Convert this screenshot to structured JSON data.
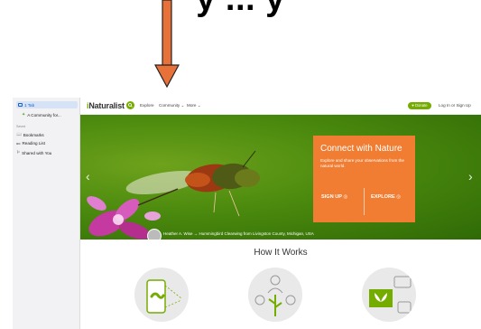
{
  "caption": "y ... y",
  "sidebar": {
    "tabs_label": "1 Tab",
    "tab_item": "A Community for...",
    "saved_label": "Saved",
    "items": [
      "Bookmarks",
      "Reading List",
      "Shared with You"
    ]
  },
  "nav": {
    "logo": "Naturalist",
    "logo_i": "i",
    "items": [
      "Explore",
      "Community",
      "More"
    ],
    "donate": "Donate",
    "login": "Log In",
    "or": "or",
    "signup": "Sign Up"
  },
  "hero": {
    "title": "Connect with Nature",
    "subtitle": "Explore and share your observations from the natural world.",
    "signup_button": "SIGN UP",
    "explore_button": "EXPLORE",
    "credit": "Heather A. Wise → Hummingbird Clearwing from Livingston County, Michigan, USA"
  },
  "how": {
    "title": "How It Works"
  },
  "colors": {
    "brand_green": "#74ac00",
    "cta_orange": "#f07d32",
    "arrow_orange": "#e8713a"
  }
}
